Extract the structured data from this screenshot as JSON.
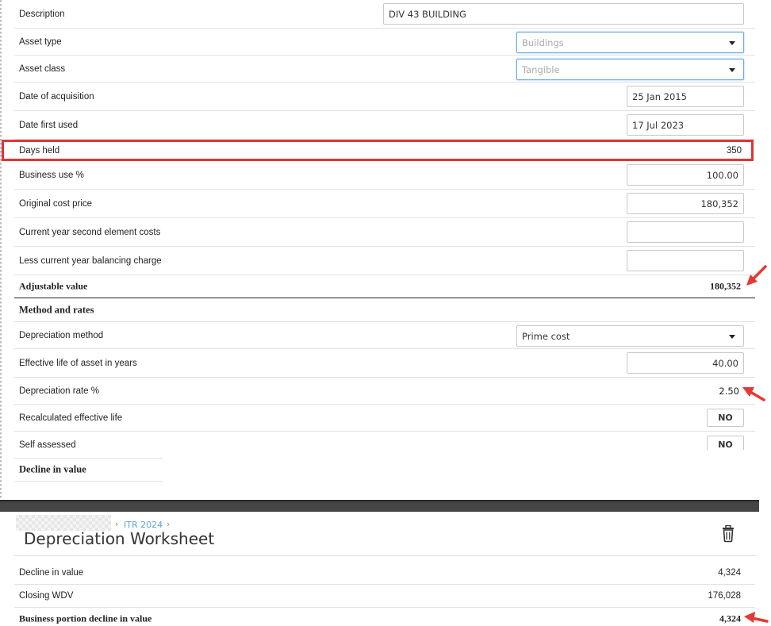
{
  "fields": {
    "description": {
      "label": "Description",
      "value": "DIV 43  BUILDING"
    },
    "asset_type": {
      "label": "Asset type",
      "value": "Buildings"
    },
    "asset_class": {
      "label": "Asset class",
      "value": "Tangible"
    },
    "date_acquisition": {
      "label": "Date of acquisition",
      "value": "25 Jan 2015"
    },
    "date_first_used": {
      "label": "Date first used",
      "value": "17 Jul 2023"
    },
    "days_held": {
      "label": "Days held",
      "value": "350"
    },
    "business_use": {
      "label": "Business use %",
      "value": "100.00"
    },
    "original_cost": {
      "label": "Original cost price",
      "value": "180,352"
    },
    "second_element": {
      "label": "Current year second element costs",
      "value": ""
    },
    "balancing_charge": {
      "label": "Less current year balancing charge",
      "value": ""
    },
    "adjustable_value": {
      "label": "Adjustable value",
      "value": "180,352"
    }
  },
  "method_section": {
    "title": "Method and rates",
    "depreciation_method": {
      "label": "Depreciation method",
      "value": "Prime cost"
    },
    "effective_life": {
      "label": "Effective life of asset in years",
      "value": "40.00"
    },
    "depreciation_rate": {
      "label": "Depreciation rate %",
      "value": "2.50"
    },
    "recalculated_life": {
      "label": "Recalculated effective life",
      "value": "NO"
    },
    "self_assessed": {
      "label": "Self assessed",
      "value": "NO"
    }
  },
  "decline_section": {
    "title": "Decline in value"
  },
  "worksheet": {
    "breadcrumb": "ITR 2024",
    "title": "Depreciation Worksheet",
    "rows": {
      "decline": {
        "label": "Decline in value",
        "value": "4,324"
      },
      "closing_wdv": {
        "label": "Closing WDV",
        "value": "176,028"
      },
      "business_portion": {
        "label": "Business portion decline in value",
        "value": "4,324"
      }
    }
  },
  "colors": {
    "highlight": "#e03535",
    "arrow": "#e53935",
    "link": "#5ba5d8",
    "focus_border": "#6aa9e0"
  }
}
